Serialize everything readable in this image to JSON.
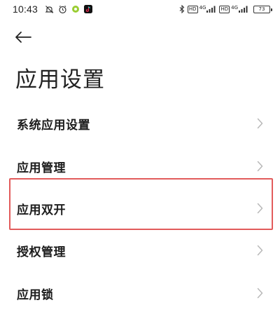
{
  "status_bar": {
    "time": "10:43",
    "signal_label_1": "4G",
    "signal_label_2": "4G",
    "hd_1": "HD",
    "hd_2": "HD",
    "battery": "73"
  },
  "header": {
    "title": "应用设置"
  },
  "menu": {
    "items": [
      {
        "label": "系统应用设置"
      },
      {
        "label": "应用管理"
      },
      {
        "label": "应用双开"
      },
      {
        "label": "授权管理"
      },
      {
        "label": "应用锁"
      }
    ]
  },
  "colors": {
    "highlight": "#e25b5b",
    "chevron": "#b8b8b8"
  }
}
